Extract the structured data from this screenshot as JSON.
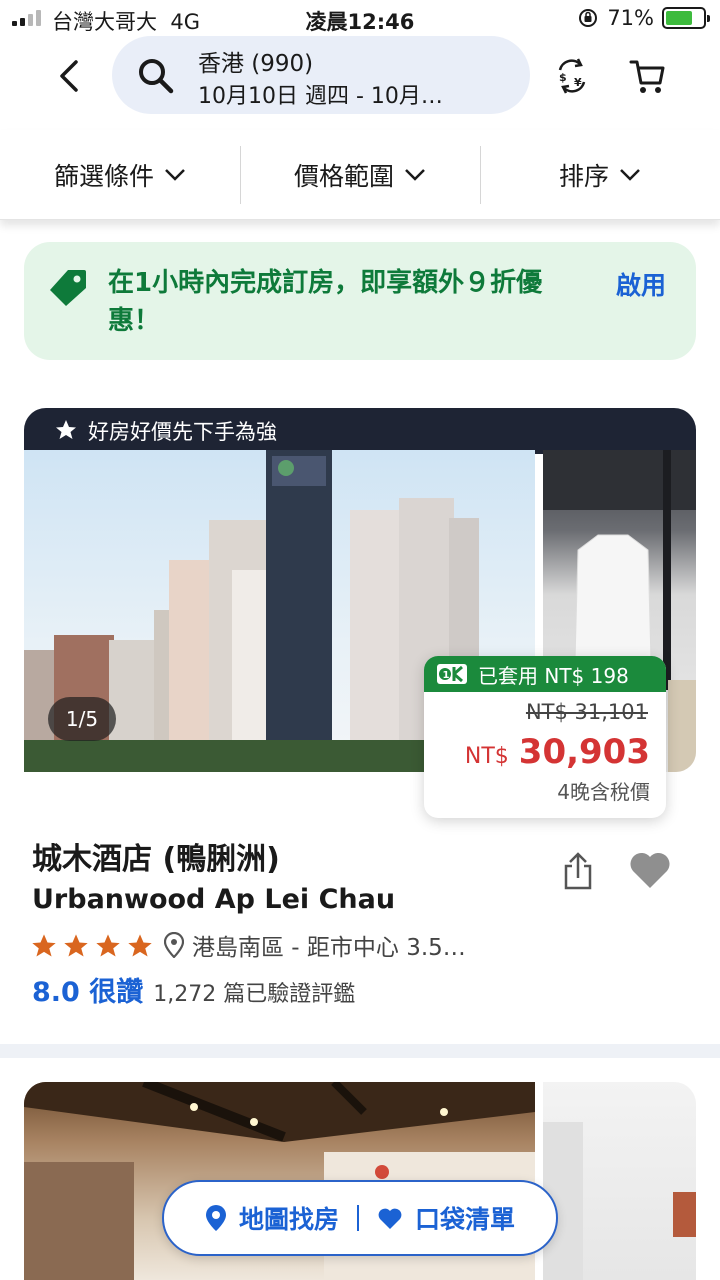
{
  "status_bar": {
    "carrier": "台灣大哥大",
    "network": "4G",
    "time": "凌晨12:46",
    "battery_percent": "71%",
    "battery_level": 0.71
  },
  "search": {
    "location": "香港 (990)",
    "dates": "10月10日 週四 - 10月…"
  },
  "filters": [
    {
      "label": "篩選條件"
    },
    {
      "label": "價格範圍"
    },
    {
      "label": "排序"
    }
  ],
  "promo": {
    "text": "在1小時內完成訂房，即享額外９折優惠！",
    "action": "啟用",
    "accent": "#0e7a3a"
  },
  "hotel": {
    "banner": "好房好價先下手為強",
    "photo_counter": "1/5",
    "discount_applied": "已套用 NT$ 198",
    "original_price": "NT$ 31,101",
    "currency": "NT$",
    "price": "30,903",
    "price_note": "4晚含稅價",
    "name_cn": "城木酒店 (鴨脷洲)",
    "name_en": "Urbanwood Ap Lei Chau",
    "star_rating": 4,
    "location": "港島南區 - 距市中心 3.5…",
    "score": "8.0 很讚",
    "reviews": "1,272 篇已驗證評鑑"
  },
  "floating_bar": {
    "map": "地圖找房",
    "wishlist": "口袋清單"
  },
  "colors": {
    "brand_blue": "#1b62d4",
    "price_red": "#d43434",
    "applied_green": "#1b8a3c",
    "star_orange": "#d9661f"
  }
}
